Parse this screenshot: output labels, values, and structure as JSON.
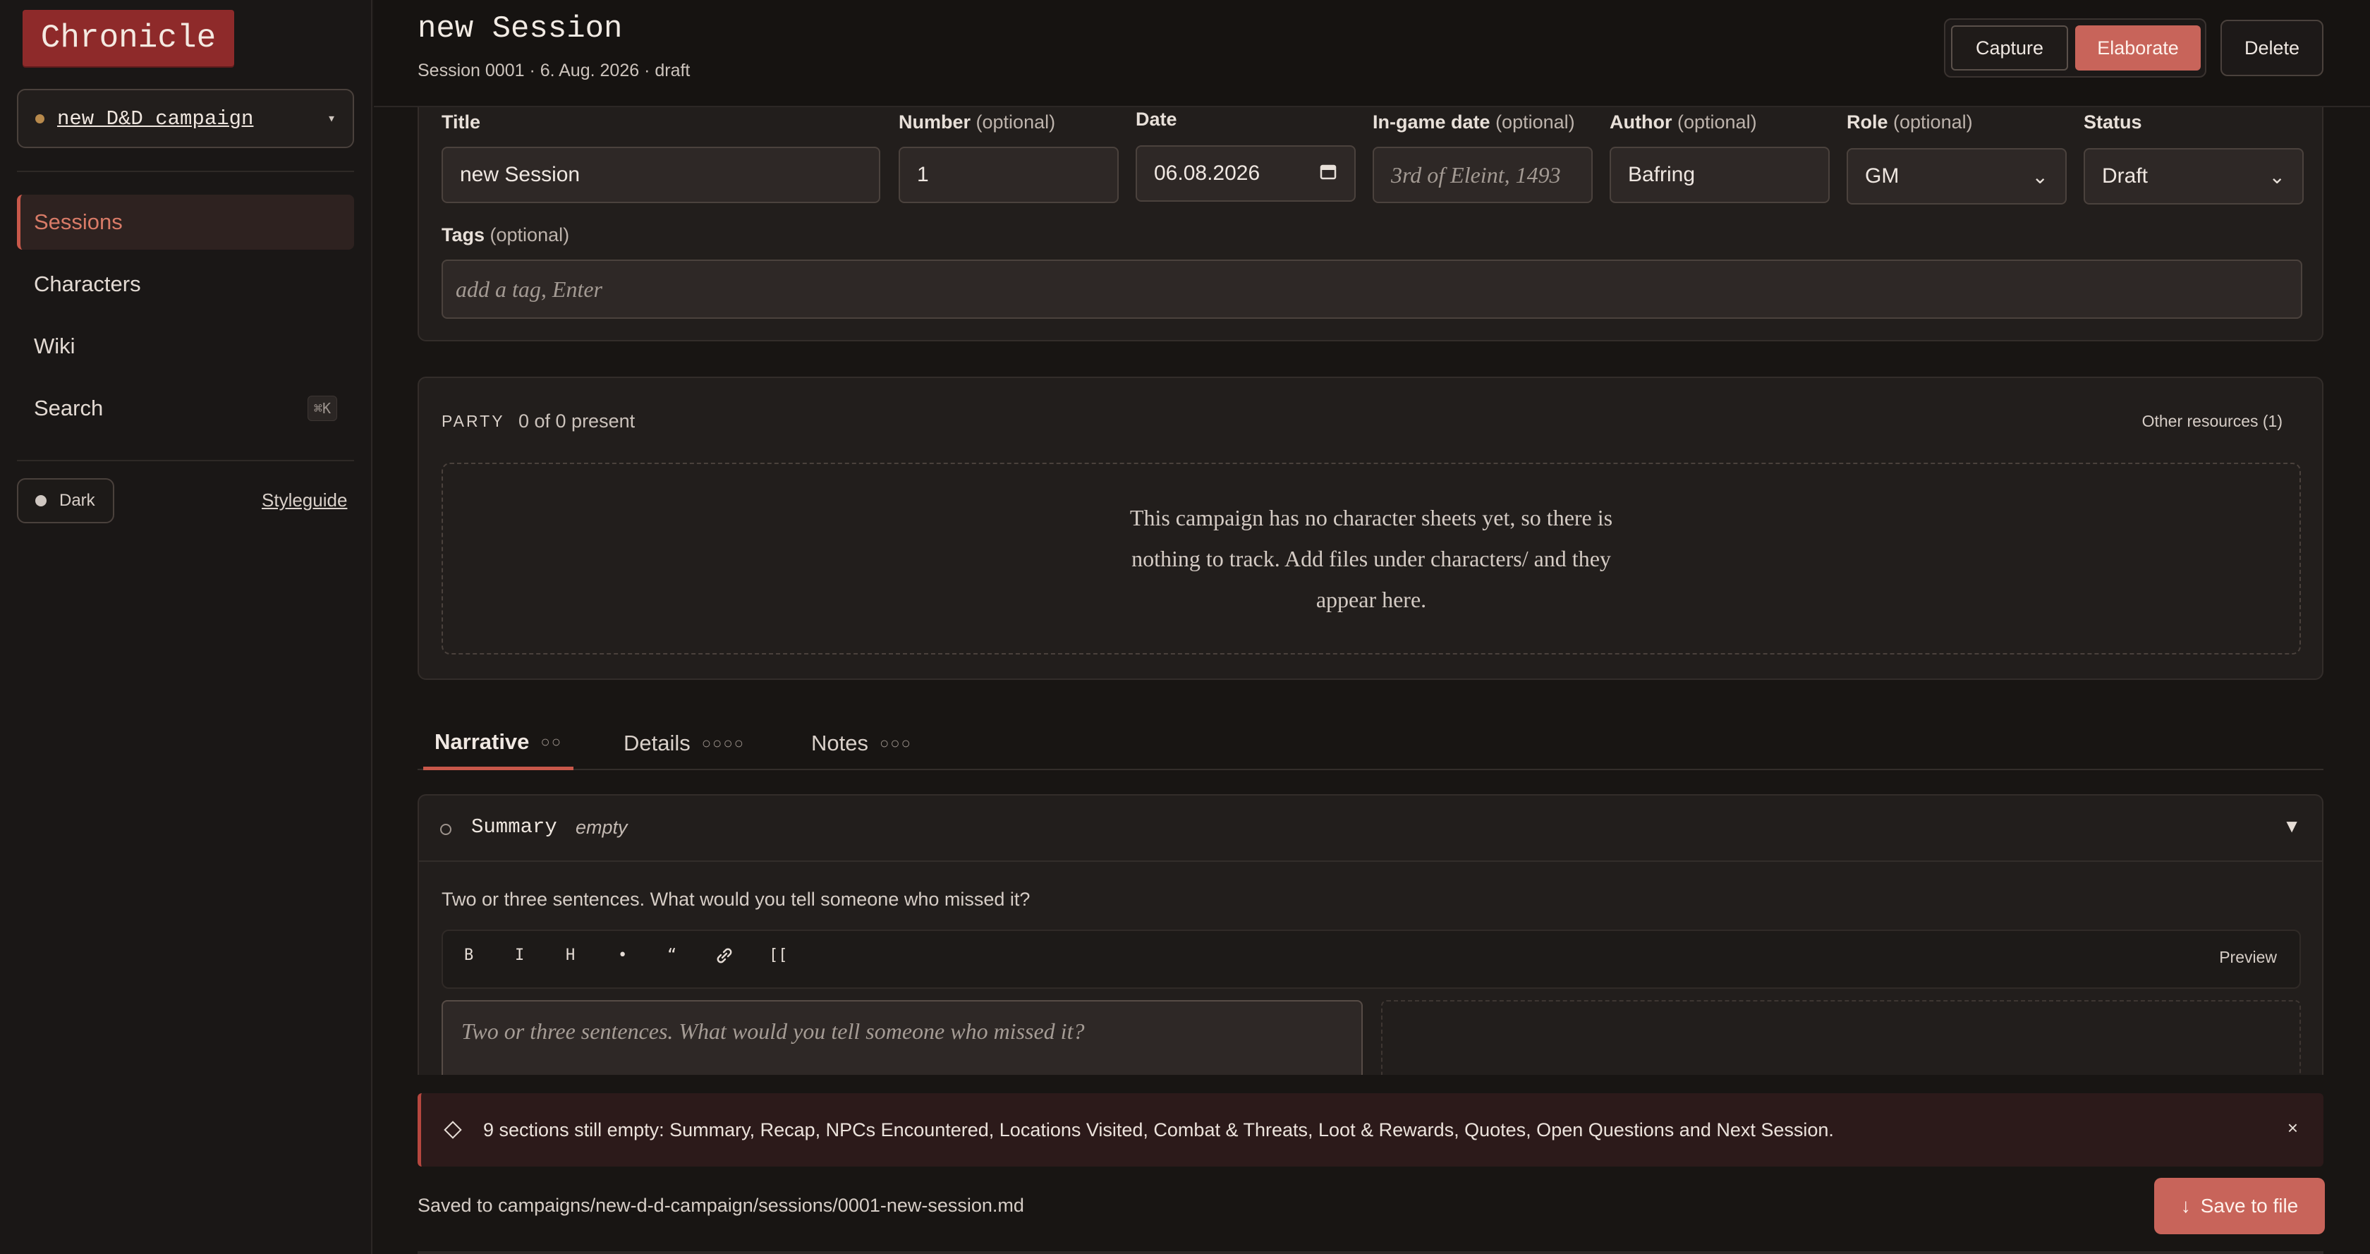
{
  "app": {
    "logo": "Chronicle"
  },
  "sidebar": {
    "campaign": "new D&D campaign",
    "campaign_caret": "▾",
    "items": [
      {
        "label": "Sessions",
        "active": true
      },
      {
        "label": "Characters"
      },
      {
        "label": "Wiki"
      },
      {
        "label": "Search",
        "shortcut": "⌘K"
      }
    ],
    "theme_toggle": "Dark",
    "styleguide_link": "Styleguide"
  },
  "header": {
    "title": "new Session",
    "subtitle": "Session 0001 · 6. Aug. 2026 · draft",
    "capture_label": "Capture",
    "elaborate_label": "Elaborate",
    "delete_label": "Delete"
  },
  "form": {
    "title": {
      "label": "Title",
      "value": "new Session"
    },
    "number": {
      "label": "Number",
      "optional": "(optional)",
      "value": "1"
    },
    "date": {
      "label": "Date",
      "value": "06.08.2026"
    },
    "ingame_date": {
      "label": "In-game date",
      "optional": "(optional)",
      "placeholder": "3rd of Eleint, 1493"
    },
    "author": {
      "label": "Author",
      "optional": "(optional)",
      "value": "Bafring"
    },
    "role": {
      "label": "Role",
      "optional": "(optional)",
      "value": "GM"
    },
    "status": {
      "label": "Status",
      "value": "Draft"
    },
    "tags": {
      "label": "Tags",
      "optional": "(optional)",
      "placeholder": "add a tag, Enter"
    }
  },
  "party": {
    "label": "PARTY",
    "count": "0 of 0 present",
    "other_resources": "Other resources (1)",
    "empty_text": "This campaign has no character sheets yet, so there is nothing to track. Add files under characters/ and they appear here."
  },
  "tabs": [
    {
      "label": "Narrative",
      "dots": "○○",
      "active": true
    },
    {
      "label": "Details",
      "dots": "○○○○"
    },
    {
      "label": "Notes",
      "dots": "○○○"
    }
  ],
  "section": {
    "title": "Summary",
    "status": "empty",
    "toggle": "▼",
    "prompt": "Two or three sentences. What would you tell someone who missed it?",
    "toolbar": [
      "B",
      "I",
      "H",
      "•",
      "“",
      "🔗",
      "[["
    ],
    "preview_label": "Preview",
    "editor_placeholder": "Two or three sentences. What would you tell someone who missed it?"
  },
  "warning": {
    "text": "9 sections still empty: Summary, Recap, NPCs Encountered, Locations Visited, Combat & Threats, Loot & Rewards, Quotes, Open Questions and Next Session.",
    "close": "×"
  },
  "footer": {
    "saved_path": "Saved to campaigns/new-d-d-campaign/sessions/0001-new-session.md",
    "save_label": "Save to file",
    "save_icon": "↓"
  },
  "colors": {
    "accent": "#c8645a",
    "logo_bg": "#8e2a2a",
    "warning_border": "#b6473f"
  }
}
